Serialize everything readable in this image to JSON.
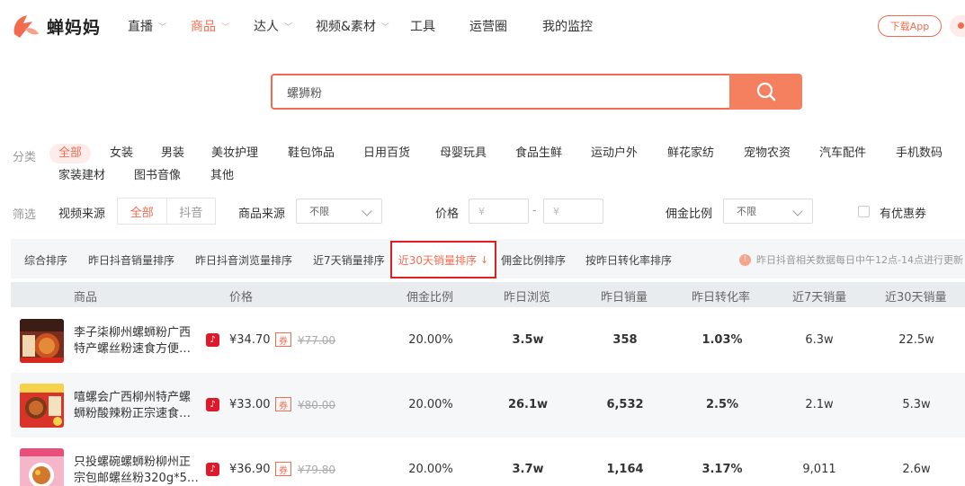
{
  "brand": {
    "name": "蝉妈妈",
    "accent": "#f26b4f"
  },
  "nav": {
    "items": [
      {
        "label": "直播",
        "has_dropdown": true,
        "active": false
      },
      {
        "label": "商品",
        "has_dropdown": true,
        "active": true
      },
      {
        "label": "达人",
        "has_dropdown": true,
        "active": false
      },
      {
        "label": "视频&素材",
        "has_dropdown": true,
        "active": false
      },
      {
        "label": "工具",
        "has_dropdown": false,
        "active": false
      },
      {
        "label": "运营圈",
        "has_dropdown": false,
        "active": false
      },
      {
        "label": "我的监控",
        "has_dropdown": false,
        "active": false
      }
    ],
    "download_label": "下载App"
  },
  "search": {
    "value": "螺狮粉",
    "button_icon": "search-icon"
  },
  "category": {
    "label": "分类",
    "items": [
      "全部",
      "女装",
      "男装",
      "美妆护理",
      "鞋包饰品",
      "日用百货",
      "母婴玩具",
      "食品生鲜",
      "运动户外",
      "鲜花家纺",
      "宠物农资",
      "汽车配件",
      "手机数码",
      "家装建材",
      "图书音像",
      "其他"
    ],
    "selected": "全部"
  },
  "filter": {
    "label": "筛选",
    "video_source_label": "视频来源",
    "video_source_options": [
      "全部",
      "抖音"
    ],
    "video_source_selected": "全部",
    "product_source_label": "商品来源",
    "product_source_value": "不限",
    "price_label": "价格",
    "price_min_placeholder": "¥",
    "price_max_placeholder": "¥",
    "price_dash": "-",
    "commission_label": "佣金比例",
    "commission_value": "不限",
    "coupon_label": "有优惠券",
    "coupon_checked": false
  },
  "sort": {
    "items": [
      "综合排序",
      "昨日抖音销量排序",
      "昨日抖音浏览量排序",
      "近7天销量排序",
      "近30天销量排序",
      "佣金比例排序",
      "按昨日转化率排序"
    ],
    "active": "近30天销量排序",
    "active_arrow": "↓",
    "notice_icon": "!",
    "notice": "昨日抖音相关数据每日中午12点-14点进行更新"
  },
  "table": {
    "headers": [
      "商品",
      "价格",
      "佣金比例",
      "昨日浏览",
      "昨日销量",
      "昨日转化率",
      "近7天销量",
      "近30天销量"
    ],
    "rows": [
      {
        "name": "李子柒柳州螺蛳粉广西特产螺丝粉速食方便…",
        "price": "¥34.70",
        "coupon": "券",
        "orig_price": "¥77.00",
        "commission": "20.00%",
        "views": "3.5w",
        "sales": "358",
        "conversion": "1.03%",
        "sales7": "6.3w",
        "sales30": "22.5w"
      },
      {
        "name": "嘻螺会广西柳州特产螺蛳粉酸辣粉正宗速食…",
        "price": "¥33.00",
        "coupon": "券",
        "orig_price": "¥80.00",
        "commission": "20.00%",
        "views": "26.1w",
        "sales": "6,532",
        "conversion": "2.5%",
        "sales7": "2.1w",
        "sales30": "5.3w"
      },
      {
        "name": "只投螺碗螺蛳粉柳州正宗包邮螺丝粉320g*5…",
        "price": "¥36.90",
        "coupon": "券",
        "orig_price": "¥79.80",
        "commission": "20.00%",
        "views": "3.7w",
        "sales": "1,164",
        "conversion": "3.17%",
        "sales7": "9,011",
        "sales30": "2.6w"
      }
    ]
  }
}
